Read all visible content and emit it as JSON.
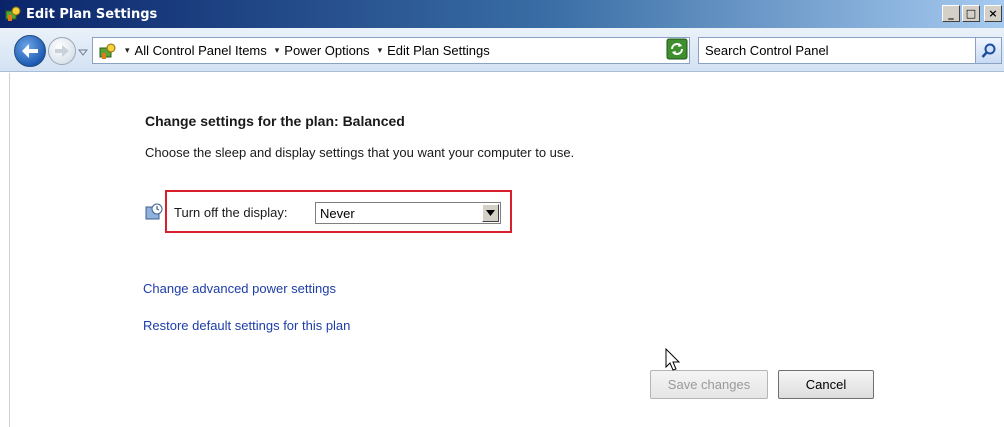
{
  "window": {
    "title": "Edit Plan Settings",
    "minimize_label": "_",
    "maximize_label": "□",
    "close_label": "×"
  },
  "navigation": {
    "breadcrumbs": [
      "All Control Panel Items",
      "Power Options",
      "Edit Plan Settings"
    ],
    "search_placeholder": "Search Control Panel"
  },
  "main": {
    "heading": "Change settings for the plan: Balanced",
    "description": "Choose the sleep and display settings that you want your computer to use.",
    "display_setting": {
      "label": "Turn off the display:",
      "value": "Never"
    },
    "links": {
      "advanced": "Change advanced power settings",
      "restore": "Restore default settings for this plan"
    },
    "buttons": {
      "save": "Save changes",
      "cancel": "Cancel"
    }
  },
  "colors": {
    "highlight": "#d7202b",
    "link": "#1d3da8"
  }
}
